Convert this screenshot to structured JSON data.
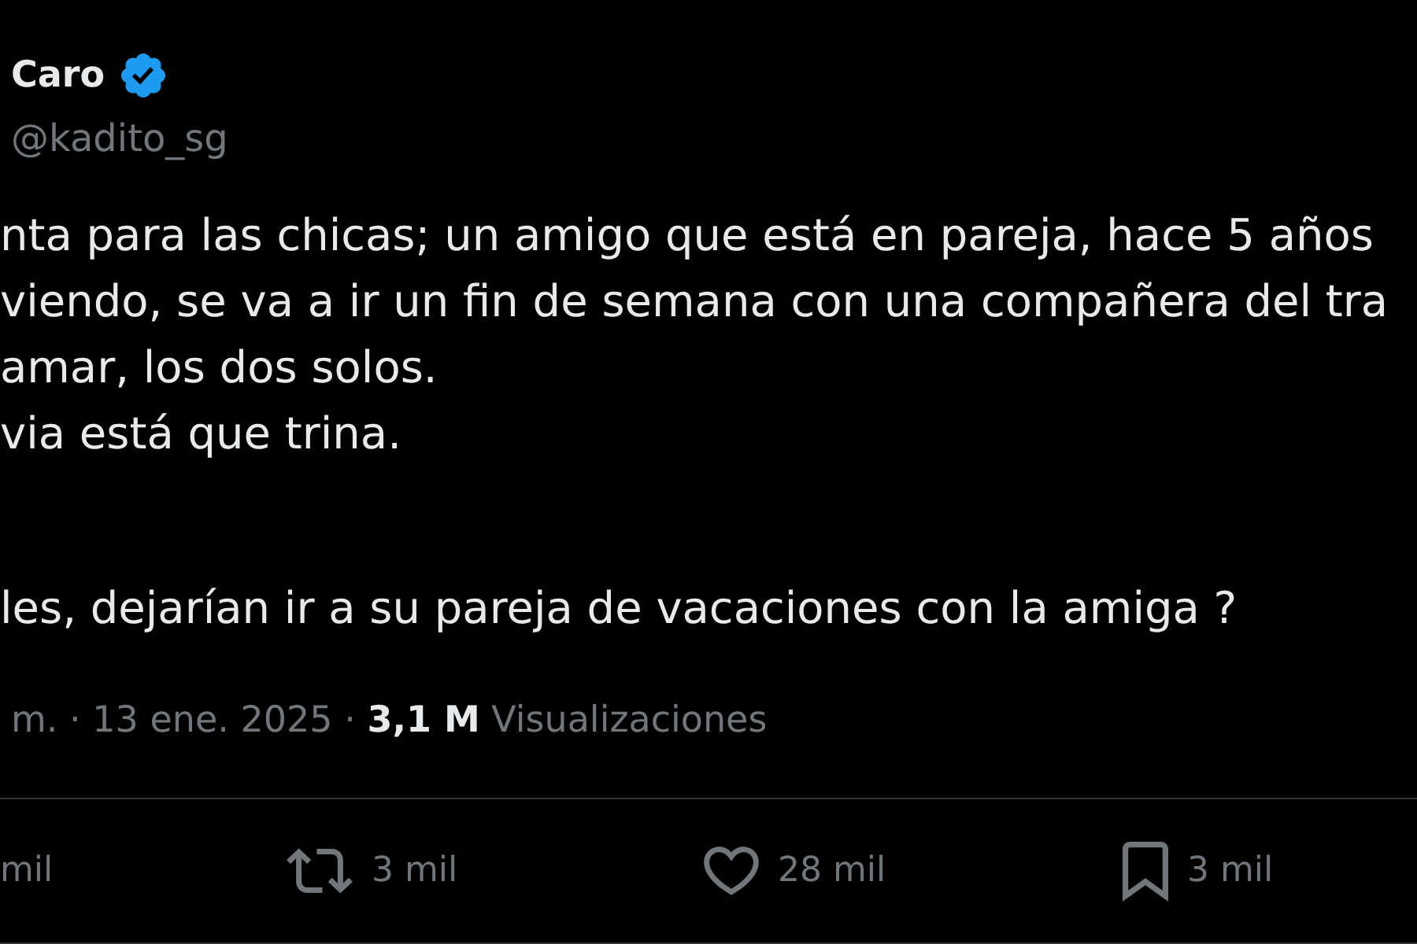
{
  "author": {
    "name": "Caro",
    "verified": true,
    "handle": "@kadito_sg"
  },
  "text": {
    "paragraphs": [
      {
        "lines": [
          "nta para las chicas; un amigo que está en pareja, hace 5 años",
          "viendo, se va a ir un fin de semana con una compañera del tra",
          "amar, los dos solos.",
          "via está que trina."
        ]
      },
      {
        "lines": [
          "les, dejarían ir a su pareja de vacaciones con la amiga ?"
        ]
      }
    ]
  },
  "meta": "m. · 13 ene. 2025 · **3,1 M** Visualizaciones",
  "actions": [
    {
      "kind": "count",
      "count": "mil"
    },
    {
      "kind": "repost",
      "count": "3 mil"
    },
    {
      "kind": "like",
      "count": "28 mil"
    },
    {
      "kind": "bookmark",
      "count": "3 mil"
    }
  ]
}
